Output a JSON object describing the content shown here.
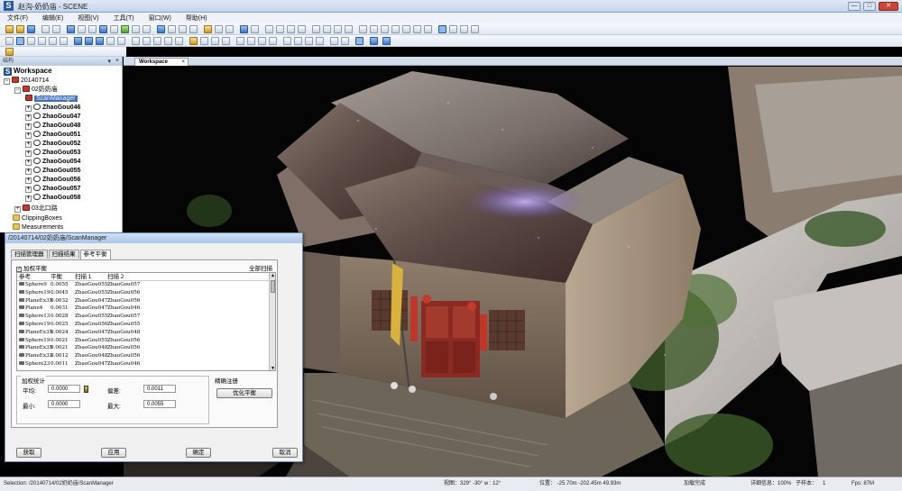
{
  "window": {
    "title": "赵沟-奶奶庙 - SCENE",
    "controls": {
      "minimize": "—",
      "maximize": "□",
      "close": "✕"
    }
  },
  "menu": [
    "文件(F)",
    "编辑(E)",
    "视图(V)",
    "工具(T)",
    "窗口(W)",
    "帮助(H)"
  ],
  "tree": {
    "panel_label": "结构",
    "root": "Workspace",
    "project": "20140714",
    "cluster": "02奶奶庙",
    "scan_manager": "ScanManager",
    "scans": [
      "ZhaoGou046",
      "ZhaoGou047",
      "ZhaoGou048",
      "ZhaoGou051",
      "ZhaoGou052",
      "ZhaoGou053",
      "ZhaoGou054",
      "ZhaoGou055",
      "ZhaoGou056",
      "ZhaoGou057",
      "ZhaoGou058"
    ],
    "sibling_cluster": "03北口路",
    "clipping_boxes": "ClippingBoxes",
    "measurements": "Measurements"
  },
  "tabs": {
    "workspace": "Workspace"
  },
  "dialog": {
    "title": "/20140714/02奶奶庙/ScanManager",
    "tabs": [
      "扫描管理器",
      "扫描结果",
      "参考平衡"
    ],
    "weighted_balance_label": "加权平衡",
    "all_scans_label": "全部扫描",
    "columns": [
      "参考",
      "平衡",
      "扫描 1",
      "扫描 2"
    ],
    "rows": [
      [
        "Sphere9",
        "0.0055",
        "ZhaoGou055",
        "ZhaoGou057"
      ],
      [
        "Sphere19",
        "0.0045",
        "ZhaoGou055",
        "ZhaoGou056"
      ],
      [
        "PlaneEx35",
        "0.0032",
        "ZhaoGou047",
        "ZhaoGou056"
      ],
      [
        "Plane4",
        "0.0031",
        "ZhaoGou047",
        "ZhaoGou046"
      ],
      [
        "Sphere13",
        "0.0028",
        "ZhaoGou055",
        "ZhaoGou057"
      ],
      [
        "Sphere19",
        "0.0025",
        "ZhaoGou056",
        "ZhaoGou055"
      ],
      [
        "PlaneEx35",
        "0.0024",
        "ZhaoGou047",
        "ZhaoGou048"
      ],
      [
        "Sphere19",
        "0.0021",
        "ZhaoGou055",
        "ZhaoGou056"
      ],
      [
        "PlaneEx35",
        "0.0021",
        "ZhaoGou048",
        "ZhaoGou056"
      ],
      [
        "PlaneEx33",
        "0.0012",
        "ZhaoGou048",
        "ZhaoGou056"
      ],
      [
        "Sphere23",
        "0.0011",
        "ZhaoGou047",
        "ZhaoGou046"
      ]
    ],
    "stats": {
      "title": "加权统计",
      "avg_label": "平均:",
      "avg_value": "0.0000",
      "min_label": "最小:",
      "min_value": "0.0000",
      "dev_label": "偏差:",
      "dev_value": "0.0011",
      "max_label": "最大:",
      "max_value": "0.0055"
    },
    "registration": {
      "title": "精确注册",
      "optimize_button": "优化平衡"
    },
    "buttons": {
      "fetch": "获取",
      "apply": "应用",
      "ok": "确定",
      "cancel": "取消"
    }
  },
  "status": {
    "selection": "Selection: /20140714/02奶奶庙/ScanManager",
    "view": "视图：329° -30° w : 12°",
    "position": "位置：  -25.70m -202.45m 49.93m",
    "load_state": "加载完成",
    "detail": "详细信息：100%",
    "subsample": "子样本：",
    "subsample_value": "1",
    "fps": "Fps: 87M"
  }
}
